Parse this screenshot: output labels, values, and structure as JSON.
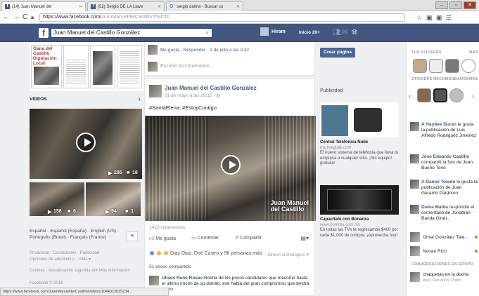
{
  "browser": {
    "tabs": [
      {
        "label": "(14) Juan Manuel del"
      },
      {
        "label": "(52) Sergio DE LA Llave"
      },
      {
        "label": "sergio dalma - Buscar co"
      }
    ],
    "url_main": "https://www.facebook.com/",
    "url_rest": "JuanManueldelCastillo/?fref=ts",
    "window_buttons": {
      "minimize": "‒",
      "maximize": "▫",
      "close": "✕"
    }
  },
  "fb_header": {
    "logo": "f",
    "search_value": "Juan Manuel del Castillo González",
    "user_name": "Hiram",
    "home_label": "Inicio",
    "home_count": "20+"
  },
  "left": {
    "cover_headline": "Gana del Castillo Diputación Local",
    "videos_title": "VIDEOS",
    "videos_arrow": "›",
    "main_video": {
      "views": "285",
      "comments": "18"
    },
    "small_video_1": {
      "views": "158",
      "comments": "6"
    },
    "small_video_2": {
      "views": "94",
      "comments": "1"
    },
    "languages": "Español · Español (España) · English (US) · Português (Brasil) · Français (France)",
    "plus": "+",
    "footer_1": "Privacidad · Condiciones · Publicidad ·",
    "footer_2": "Opciones de anuncios ▷ · Más ▾",
    "footer_3": "Cookies · Actualización sugerida por Más información",
    "footer_4": "Facebook © 2016"
  },
  "post_top": {
    "actions": "Me gusta · Responder · 2 de julio a las 0:42",
    "comment_placeholder": "Escribe un comentario..."
  },
  "post": {
    "author": "Juan Manuel del Castillo González",
    "time": "31 de mayo a las 20:15 · ◍",
    "hashtags": "#SantaElena, #EstoyContigo",
    "photo_logo_1": "Juan Manuel",
    "photo_logo_2": "del Castillo",
    "impressions": "1413 impresiones",
    "like": "Me gusta",
    "comment": "Comentar",
    "share": "Compartir",
    "reactions": "Diaz Diaz, Doe Castro y 98 personas más",
    "order": "Orden cronológico ▾",
    "shares": "21 veces compartido",
    "comment_author": "Ulises Rene Rosas",
    "comment_text": "Rocha de los pocos candidatos que mecomo hasta el último rincón de su distrito, ese habla del gran compromiso que tendrá como"
  },
  "ads": {
    "create_page": "Crear página",
    "section_title": "Publicidad",
    "ad1_title": "Central Telefónica Nube",
    "ad1_site": "mx.livegtalk.com",
    "ad1_body": "El nuevo sistema de telefonía que lleva tu empresa a cualquier sitio. ¡Sin equipo! gratuito!",
    "ad2_title": "Capacítate con Bonanza",
    "ad2_site": "www.bonfoto.com.mx",
    "ad2_body": "En todas las TVs te regresamos $400 por cada $1,000 de compra. ¡Aprovecha hoy!"
  },
  "right": {
    "stickers_title": "TUS STICKERS",
    "stickers_more": "MÁS",
    "recommended_title": "STICKERS RECOMENDADOS",
    "recommended_more": "MÁS",
    "ticker": [
      {
        "name": "A Haydee Duran",
        "text": "le gusta la publicación de Luis Alfredo Rodriguez Jimenez"
      },
      {
        "name": "Jose Eduardo Castillo",
        "text": "compartió la foto de Juan Bueno Torio"
      },
      {
        "name": "A Daniel Toledo",
        "text": "le gusta la publicación de Juan Gerardo Pardomo"
      },
      {
        "name": "Diana Matiia",
        "text": "respondió el comentario de Jonathan Banda Ginéz."
      }
    ],
    "chat": [
      {
        "name": "Omar González Tala..."
      },
      {
        "name": "Nonan Rich"
      }
    ],
    "group_title": "CONVERSACIONES EN GRUPO",
    "group_name": "chaquetas en la ducha",
    "group_members": "Alex, Fernando, Pedro"
  },
  "statusbar": "https://www.facebook.com/JuanManueldelCastillo/videos/1044322035234..."
}
